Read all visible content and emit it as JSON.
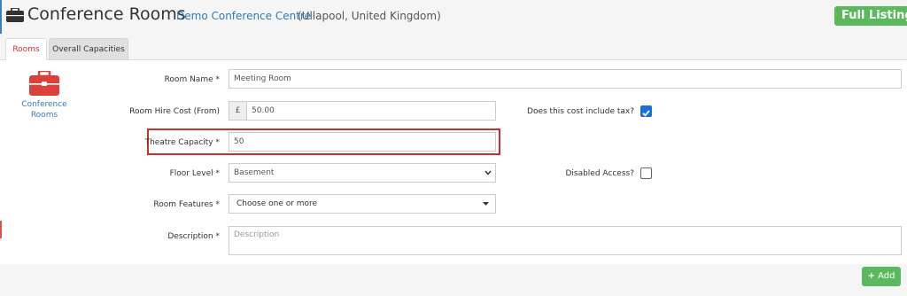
{
  "header": {
    "title": "Conference Rooms",
    "venue_name": "Demo Conference Centre",
    "venue_location": "(Ullapool, United Kingdom)",
    "full_listing_label": "Full Listing"
  },
  "tabs": [
    {
      "label": "Rooms",
      "active": true
    },
    {
      "label": "Overall Capacities",
      "active": false
    }
  ],
  "sidebar": {
    "label": "Conference Rooms",
    "icon": "briefcase-icon"
  },
  "form": {
    "room_name": {
      "label": "Room Name",
      "required_mark": "*",
      "value": "Meeting Room"
    },
    "room_hire_cost": {
      "label": "Room Hire Cost (From)",
      "currency": "£",
      "value": "50.00"
    },
    "include_tax": {
      "label": "Does this cost include tax?",
      "checked": true
    },
    "theatre_capacity": {
      "label": "Theatre Capacity",
      "required_mark": "*",
      "value": "50"
    },
    "floor_level": {
      "label": "Floor Level",
      "required_mark": "*",
      "value": "Basement"
    },
    "disabled_access": {
      "label": "Disabled Access?",
      "checked": false
    },
    "room_features": {
      "label": "Room Features",
      "required_mark": "*",
      "placeholder": "Choose one or more"
    },
    "description": {
      "label": "Description",
      "required_mark": "*",
      "placeholder": "Description"
    }
  },
  "actions": {
    "add_label": "Add"
  },
  "colors": {
    "accent_green": "#5cb85c",
    "link_blue": "#337ab7",
    "highlight_red": "#c9302c",
    "checkbox_blue": "#1e6fd9"
  }
}
